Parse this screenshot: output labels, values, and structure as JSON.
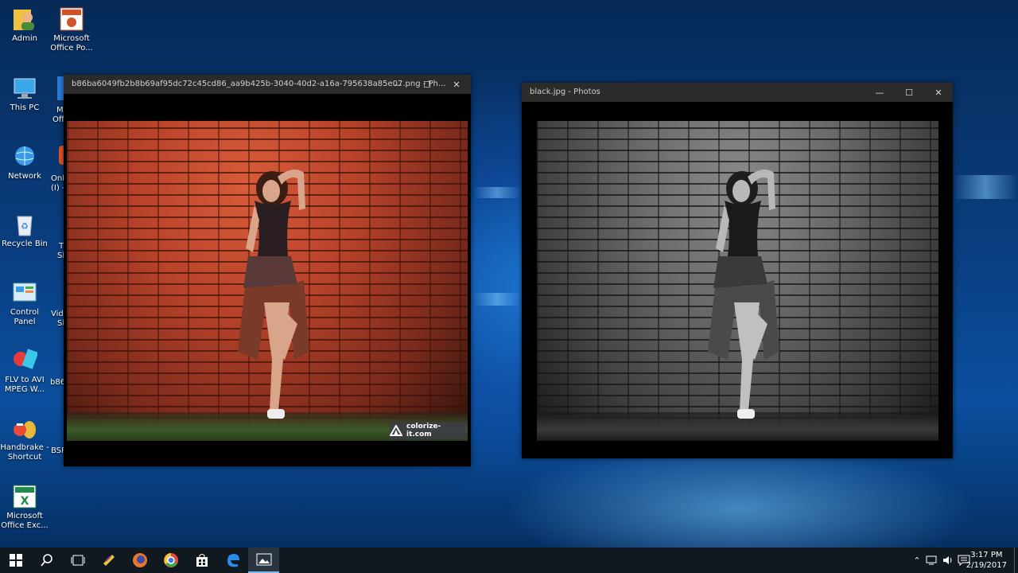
{
  "desktop": {
    "icons": [
      {
        "label": "Admin",
        "icon": "user-folder-icon"
      },
      {
        "label": "Microsoft Office Po...",
        "icon": "powerpoint-icon"
      },
      {
        "label": "This PC",
        "icon": "computer-icon"
      },
      {
        "label": "Network",
        "icon": "network-icon"
      },
      {
        "label": "Recycle Bin",
        "icon": "recycle-bin-icon"
      },
      {
        "label": "Control Panel",
        "icon": "control-panel-icon"
      },
      {
        "label": "FLV to AVI MPEG W...",
        "icon": "converter-icon"
      },
      {
        "label": "Handbrake - Shortcut",
        "icon": "handbrake-icon"
      },
      {
        "label": "Microsoft Office Exc...",
        "icon": "excel-icon"
      }
    ],
    "clipped_labels": [
      "M",
      "Offi",
      "Onl",
      "(I) -",
      "T",
      "Sl",
      "Vid",
      "Sl",
      "b86",
      "BSR"
    ]
  },
  "window_left": {
    "title": "b86ba6049fb2b8b69af95dc72c45cd86_aa9b425b-3040-40d2-a16a-795638a85e07.png - Ph...",
    "watermark": "colorize-it.com",
    "controls": {
      "minimize": "—",
      "maximize": "☐",
      "close": "✕"
    }
  },
  "window_right": {
    "title": "black.jpg - Photos",
    "controls": {
      "minimize": "—",
      "maximize": "☐",
      "close": "✕"
    }
  },
  "taskbar": {
    "apps": [
      "start-icon",
      "search-icon",
      "task-view-icon",
      "winrar-icon",
      "firefox-icon",
      "chrome-icon",
      "store-icon",
      "edge-icon",
      "photos-icon"
    ],
    "time": "3:17 PM",
    "date": "2/19/2017"
  }
}
